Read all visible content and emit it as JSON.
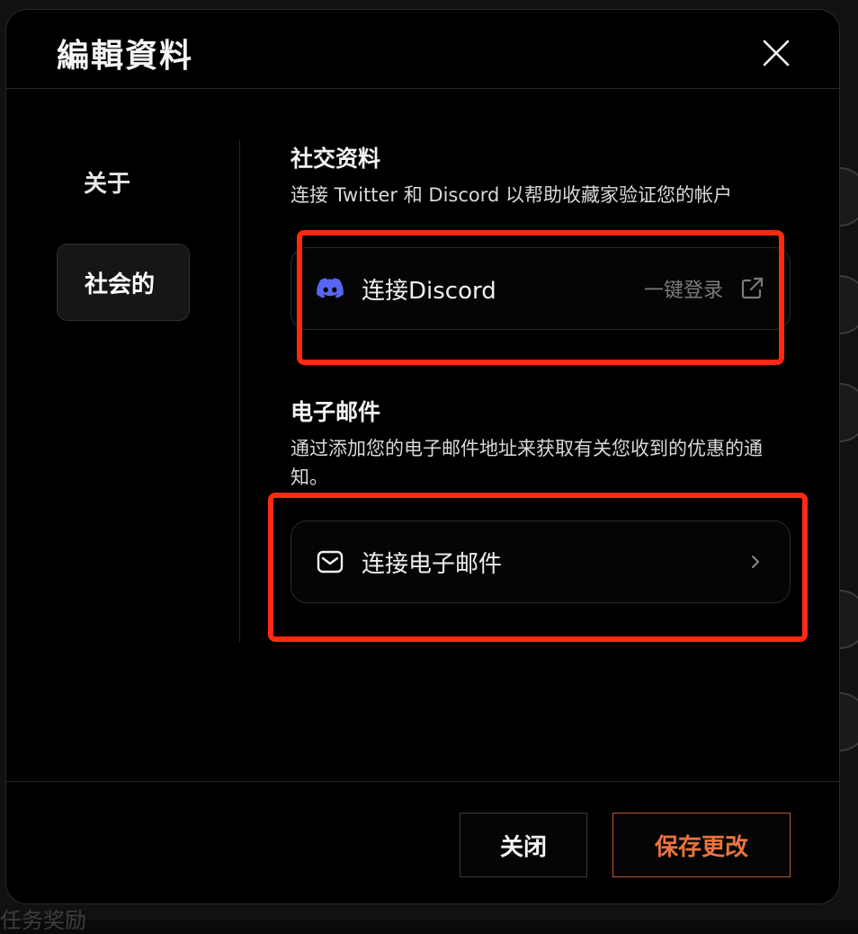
{
  "modal": {
    "title": "編輯資料",
    "close_icon": "close-x-icon"
  },
  "nav": {
    "items": [
      {
        "label": "关于",
        "active": false
      },
      {
        "label": "社会的",
        "active": true
      }
    ]
  },
  "social": {
    "title": "社交资料",
    "description": "连接 Twitter 和 Discord 以帮助收藏家验证您的帐户",
    "discord": {
      "icon": "discord-icon",
      "label": "连接Discord",
      "hint": "一键登录",
      "hint_icon": "external-link-icon",
      "icon_color": "#5865F2"
    }
  },
  "email": {
    "title": "电子邮件",
    "description": "通过添加您的电子邮件地址来获取有关您收到的优惠的通知。",
    "connect": {
      "icon": "mail-icon",
      "label": "连接电子邮件",
      "chevron_icon": "chevron-right-icon"
    }
  },
  "footer": {
    "close_label": "关闭",
    "save_label": "保存更改",
    "save_color": "#e8743f"
  },
  "background": {
    "bottom_text": "任务奖励"
  },
  "annotation": {
    "highlight_color": "#ff2a12"
  }
}
